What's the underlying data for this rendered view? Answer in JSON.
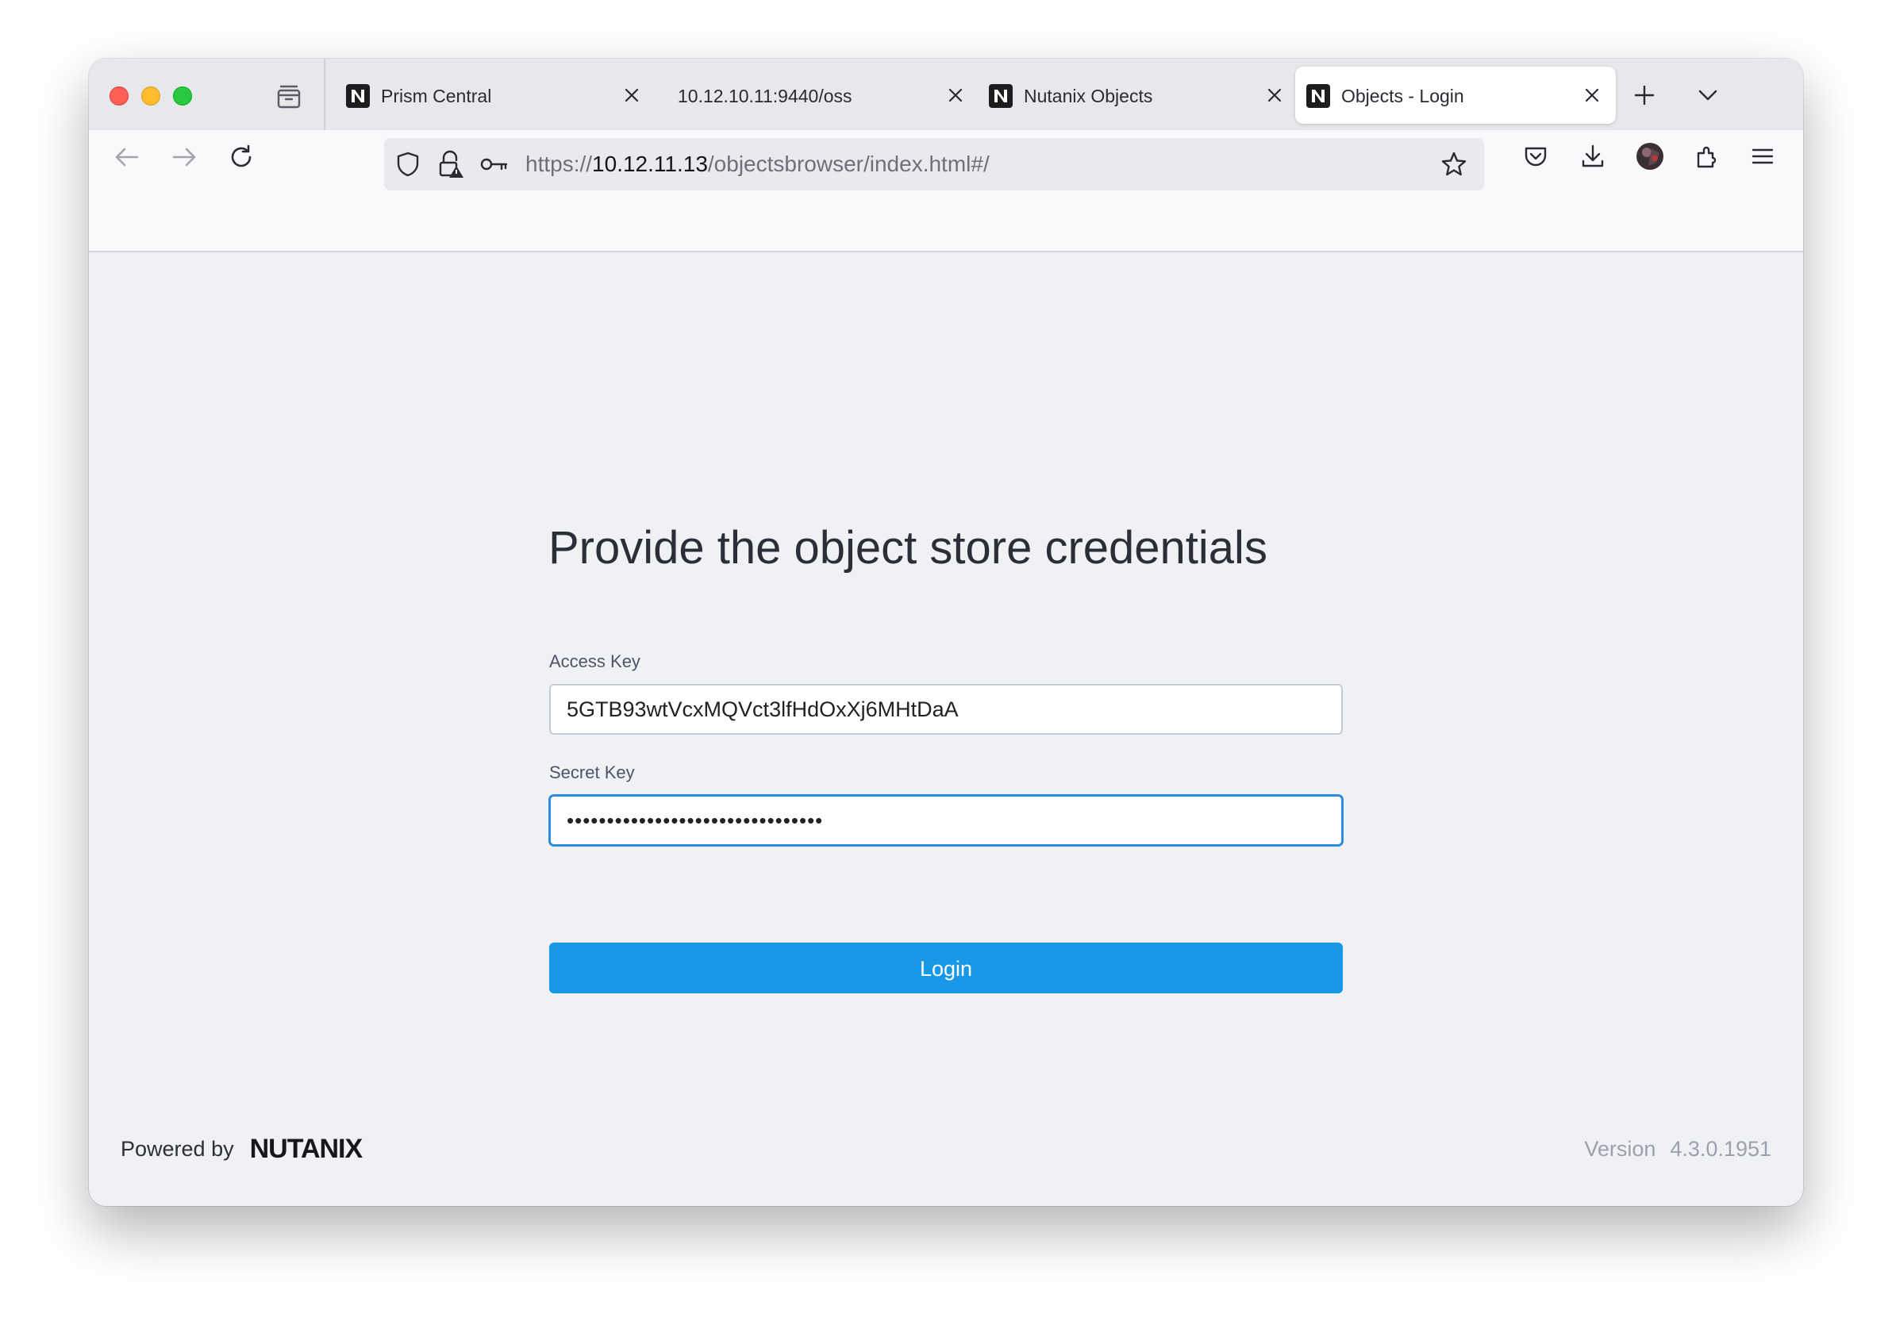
{
  "browser": {
    "tabs": [
      {
        "title": "Prism Central",
        "icon": "nutanix-favicon",
        "active": false
      },
      {
        "title": "10.12.10.11:9440/oss",
        "icon": "",
        "active": false
      },
      {
        "title": "Nutanix Objects",
        "icon": "nutanix-favicon",
        "active": false
      },
      {
        "title": "Objects - Login",
        "icon": "nutanix-favicon",
        "active": true
      }
    ],
    "url": {
      "scheme": "https://",
      "host": "10.12.11.13",
      "path": "/objectsbrowser/index.html#/"
    }
  },
  "login": {
    "heading": "Provide the object store credentials",
    "access_key_label": "Access Key",
    "access_key_value": "5GTB93wtVcxMQVct3lfHdOxXj6MHtDaA",
    "secret_key_label": "Secret Key",
    "secret_key_masked": "••••••••••••••••••••••••••••••••",
    "login_label": "Login"
  },
  "footer": {
    "powered_by": "Powered by",
    "brand": "NUTANIX",
    "version_label": "Version",
    "version": "4.3.0.1951"
  },
  "colors": {
    "primary_button": "#1a98e8",
    "focus_border": "#2b8de1",
    "page_background": "#f0f1f4"
  }
}
